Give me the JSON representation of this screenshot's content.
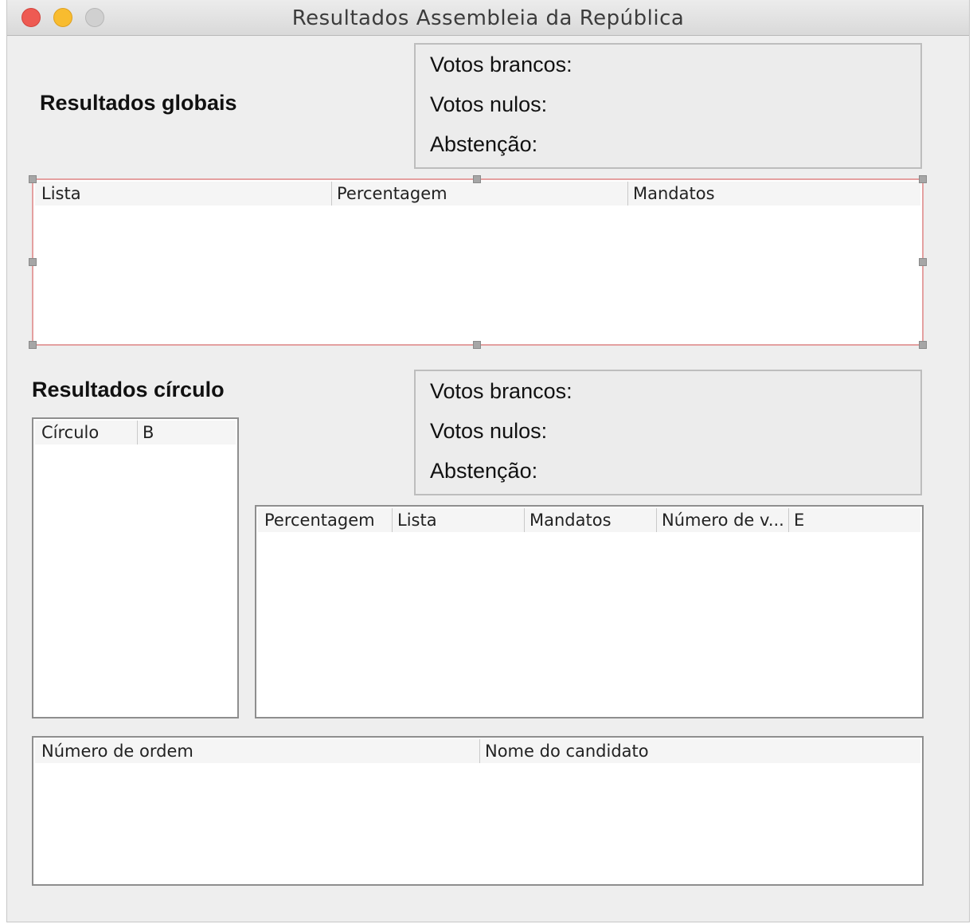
{
  "window": {
    "title": "Resultados Assembleia da República"
  },
  "global": {
    "heading": "Resultados globais",
    "stats": {
      "brancos": "Votos brancos:",
      "nulos": "Votos nulos:",
      "abstencao": "Abstenção:"
    },
    "table": {
      "columns": [
        "Lista",
        "Percentagem",
        "Mandatos"
      ]
    }
  },
  "circulo": {
    "heading": "Resultados círculo",
    "stats": {
      "brancos": "Votos brancos:",
      "nulos": "Votos nulos:",
      "abstencao": "Abstenção:"
    },
    "circulo_table": {
      "columns": [
        "Círculo",
        "B"
      ]
    },
    "results_table": {
      "columns": [
        "Percentagem",
        "Lista",
        "Mandatos",
        "Número de v...",
        "E"
      ]
    }
  },
  "candidates_table": {
    "columns": [
      "Número de ordem",
      "Nome do candidato"
    ]
  }
}
